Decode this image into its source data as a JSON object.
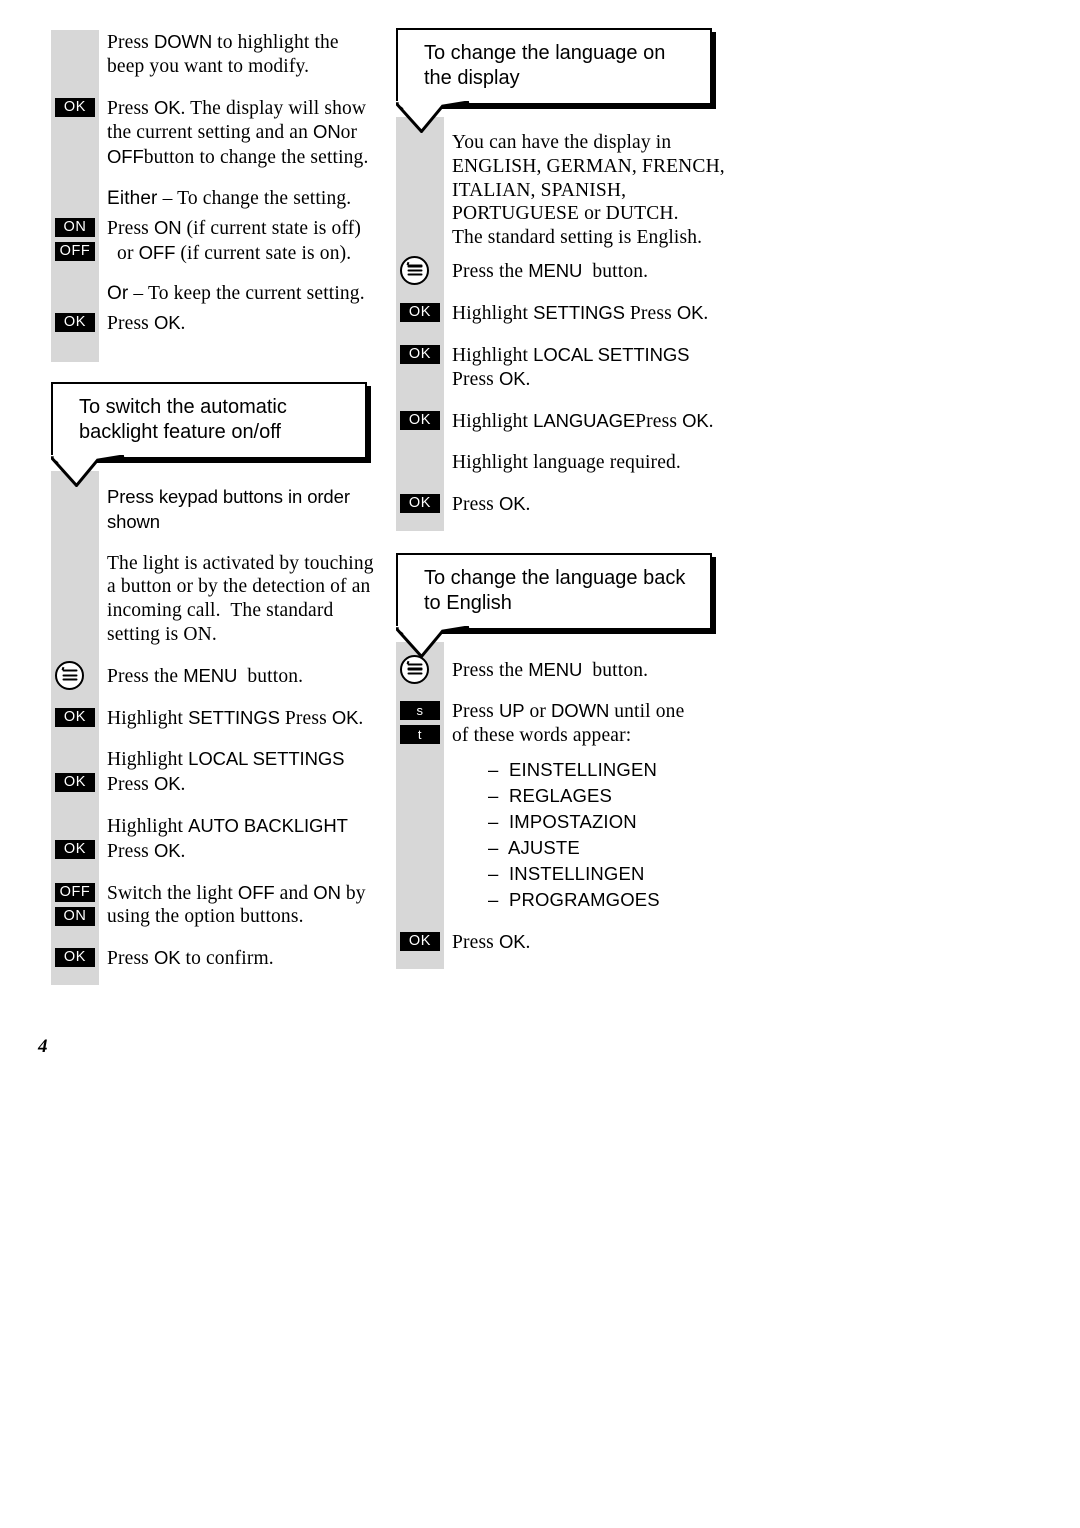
{
  "page": {
    "number": "4"
  },
  "left_column": {
    "beep_section": {
      "rows": [
        {
          "badge": null,
          "text_html": "Press <span class=\"s\">DOWN</span> to highlight the<br>beep you want to modify."
        },
        {
          "badge": "OK",
          "text_html": "Press <span class=\"s\">OK</span>. The display will show<br>the current setting and an <span class=\"s\">ON</span>or<br><span class=\"s\">OFF</span>button to change the setting."
        },
        {
          "badge": null,
          "text_html": "<span class=\"sbold\">Either</span> &ndash; To change the setting."
        },
        {
          "badge": "ON/OFF",
          "text_html": "Press <span class=\"s\">ON</span> (if current state is off)<br>&nbsp;&nbsp;or <span class=\"s\">OFF</span> (if current sate is on)."
        },
        {
          "badge": null,
          "text_html": "<span class=\"sbold\">Or</span> &ndash; To keep the current setting."
        },
        {
          "badge": "OK",
          "text_html": "Press <span class=\"s\">OK</span>."
        }
      ]
    },
    "backlight_callout": {
      "line1": "To switch the automatic",
      "line2": "backlight feature on/off"
    },
    "backlight_section": {
      "rows": [
        {
          "badge": null,
          "text_html": "<span class=\"s\">Press keypad buttons in order shown</span>"
        },
        {
          "badge": null,
          "text_html": "The light is activated by touching<br>a button or by the detection of an<br>incoming call.&nbsp; The standard<br>setting is ON."
        },
        {
          "badge": "MENU",
          "text_html": "Press the <span class=\"s\">MENU</span>&nbsp; button."
        },
        {
          "badge": "OK",
          "text_html": "Highlight <span class=\"s\">SETTINGS</span><span class=\"s\"> </span>Press <span class=\"s\">OK</span>."
        },
        {
          "badge": "OK",
          "text_html": "Highlight <span class=\"s\">LOCAL SETTINGS</span><br>Press <span class=\"s\">OK</span>."
        },
        {
          "badge": "OK",
          "text_html": "Highlight <span class=\"s\">AUTO BACKLIGHT</span><br>Press <span class=\"s\">OK</span>."
        },
        {
          "badge": "OFF/ON",
          "text_html": "Switch the light <span class=\"s\">OFF</span> and <span class=\"s\">ON</span> by<br>using the option buttons."
        },
        {
          "badge": "OK",
          "text_html": "Press <span class=\"s\">OK</span> to confirm."
        }
      ]
    }
  },
  "right_column": {
    "language_callout": {
      "line1": "To change the language on",
      "line2": "the display"
    },
    "language_section": {
      "rows": [
        {
          "badge": null,
          "text_html": "You can have the display in<br>ENGLISH, GERMAN, FRENCH,<br>ITALIAN, SPANISH,<br>PORTUGUESE or DUTCH.<br>The standard setting is English."
        },
        {
          "badge": "MENU",
          "text_html": "Press the <span class=\"s\">MENU</span>&nbsp; button."
        },
        {
          "badge": "OK",
          "text_html": "Highlight <span class=\"s\">SETTINGS</span><span class=\"s\"> </span>Press <span class=\"s\">OK</span>."
        },
        {
          "badge": "OK",
          "text_html": "Highlight <span class=\"s\">LOCAL SETTINGS</span><br>Press <span class=\"s\">OK</span>."
        },
        {
          "badge": "OK",
          "text_html": "Highlight <span class=\"s\">LANGUAGE</span>Press <span class=\"s\">OK</span>."
        },
        {
          "badge": null,
          "text_html": "Highlight language required."
        },
        {
          "badge": "OK",
          "text_html": "Press <span class=\"s\">OK</span>."
        }
      ]
    },
    "english_callout": {
      "line1": "To change the language back",
      "line2": "to English"
    },
    "english_section": {
      "rows": [
        {
          "badge": "MENU",
          "text_html": "Press the <span class=\"s\">MENU</span>&nbsp; button."
        },
        {
          "badge": "UPDOWN",
          "text_html": "Press <span class=\"s\">UP</span> or <span class=\"s\">DOWN</span> until one<br>of these words appear:"
        }
      ],
      "words": [
        "–  EINSTELLINGEN",
        "–  REGLAGES",
        "–  IMPOSTAZION",
        "–  AJUSTE",
        "–  INSTELLINGEN",
        "–  PROGRAMGOES"
      ],
      "final_row": {
        "badge": "OK",
        "text_html": "Press <span class=\"s\">OK</span>."
      }
    }
  },
  "labels": {
    "ok": "OK",
    "on": "ON",
    "off": "OFF",
    "arrow_up": "s",
    "arrow_down": "t",
    "menu_icon": "menu-icon"
  },
  "colors": {
    "rail_gray": "#d7d7d7",
    "badge_black": "#000000",
    "badge_text": "#ffffff",
    "page_background": "#ffffff",
    "text": "#000000"
  }
}
